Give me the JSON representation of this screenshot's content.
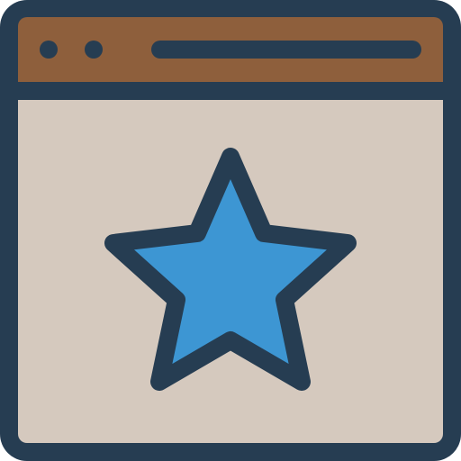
{
  "icon": {
    "name": "browser-window-star-icon",
    "colors": {
      "outline": "#263d52",
      "title_bar": "#8e5f3c",
      "window_body": "#d5c9be",
      "star_fill": "#3d96d3",
      "dot": "#263d52"
    },
    "parts": {
      "window_controls": [
        "dot",
        "dot"
      ],
      "address_bar": "address-bar-line",
      "center_symbol": "star-icon"
    }
  }
}
